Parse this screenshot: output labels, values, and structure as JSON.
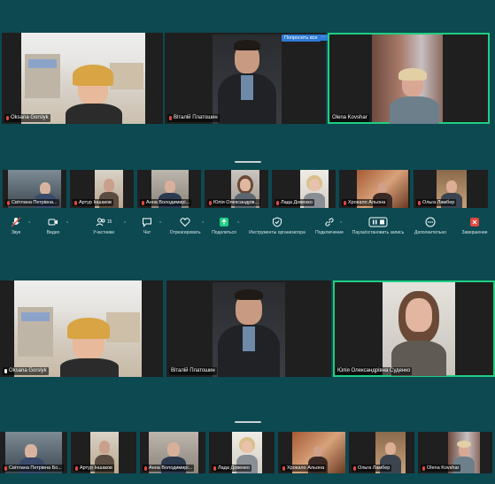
{
  "shot1": {
    "main_tiles": [
      {
        "name": "Oksana Gorslyk",
        "muted": true
      },
      {
        "name": "Віталій Платошин",
        "muted": true
      },
      {
        "name": "Olena Kovshar",
        "muted": false
      }
    ],
    "ask_button": "Попросить все",
    "more_button": "···",
    "strip_tiles": [
      {
        "name": "Світлана Петрівна..."
      },
      {
        "name": "Артур Іншаков"
      },
      {
        "name": "Анна Володимирі..."
      },
      {
        "name": "Юлія Олександрів..."
      },
      {
        "name": "Лада Довенко"
      },
      {
        "name": "Хрокало Альона"
      },
      {
        "name": "Ольга Ламбер"
      }
    ],
    "toolbar": [
      {
        "label": "Звук",
        "icon": "mic-icon"
      },
      {
        "label": "Видео",
        "icon": "video-icon"
      },
      {
        "label": "Участники",
        "icon": "participants-icon",
        "count": "15"
      },
      {
        "label": "Чат",
        "icon": "chat-icon"
      },
      {
        "label": "Отреагировать",
        "icon": "heart-icon"
      },
      {
        "label": "Поделиться",
        "icon": "share-icon"
      },
      {
        "label": "Инструменты организатора",
        "icon": "shield-icon"
      },
      {
        "label": "Подключение",
        "icon": "link-icon"
      },
      {
        "label": "Пауза/остановить запись",
        "icon": "record-icon"
      },
      {
        "label": "Дополнительно",
        "icon": "more-icon"
      },
      {
        "label": "Завершение",
        "icon": "end-icon"
      }
    ]
  },
  "shot2": {
    "main_tiles": [
      {
        "name": "Oksana Gorslyk",
        "muted": false
      },
      {
        "name": "Віталій Платошин",
        "muted": false
      },
      {
        "name": "Юлія Олександрівна Суденко",
        "muted": false
      }
    ],
    "strip_tiles": [
      {
        "name": "Світлана Петрівна Бо..."
      },
      {
        "name": "Артур Іншаков"
      },
      {
        "name": "Анна Володимирі..."
      },
      {
        "name": "Лада Довенко"
      },
      {
        "name": "Хрокало Альона"
      },
      {
        "name": "Ольга Ламбер"
      },
      {
        "name": "Olena Kovshar"
      }
    ]
  },
  "colors": {
    "background": "#0c4951",
    "active_speaker": "#1fcf80",
    "end_button": "#e0483e",
    "accent": "#2d7bd6"
  }
}
